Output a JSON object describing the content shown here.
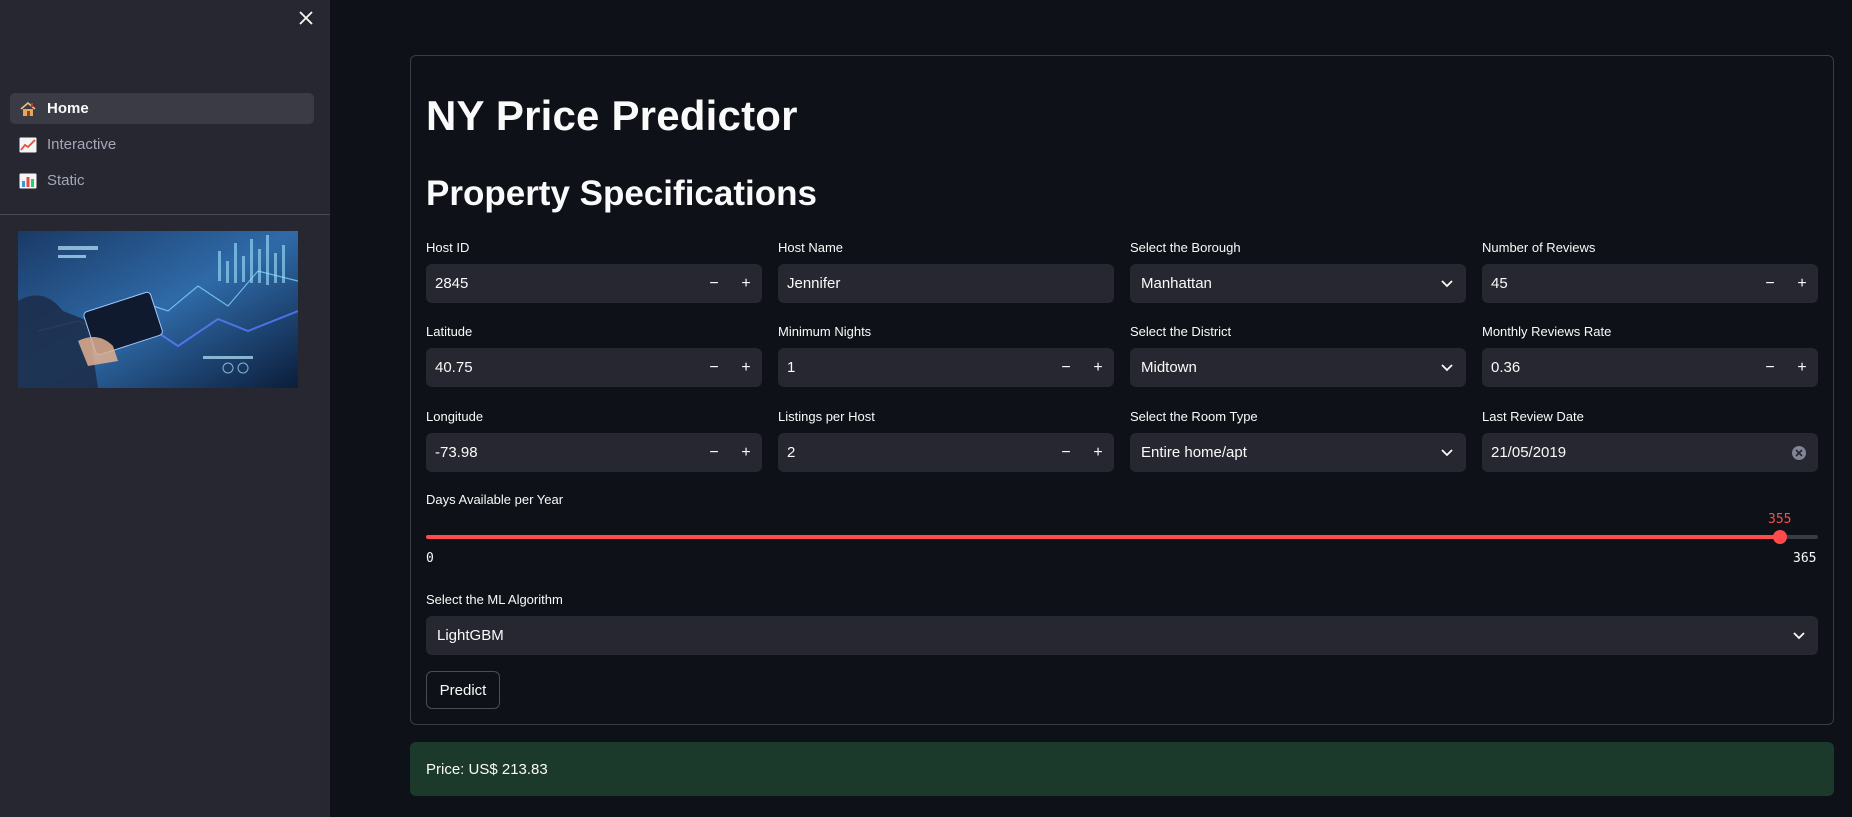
{
  "sidebar": {
    "close_icon": "close-icon",
    "items": [
      {
        "label": "Home",
        "icon": "house-icon",
        "active": true
      },
      {
        "label": "Interactive",
        "icon": "chart-increasing-icon",
        "active": false
      },
      {
        "label": "Static",
        "icon": "bar-chart-icon",
        "active": false
      }
    ],
    "image_icon": "finance-tablet-image"
  },
  "main": {
    "title": "NY Price Predictor",
    "section_title": "Property Specifications"
  },
  "fields": {
    "host_id": {
      "label": "Host ID",
      "value": "2845"
    },
    "host_name": {
      "label": "Host Name",
      "value": "Jennifer"
    },
    "borough": {
      "label": "Select the Borough",
      "value": "Manhattan"
    },
    "num_reviews": {
      "label": "Number of Reviews",
      "value": "45"
    },
    "latitude": {
      "label": "Latitude",
      "value": "40.75"
    },
    "min_nights": {
      "label": "Minimum Nights",
      "value": "1"
    },
    "district": {
      "label": "Select the District",
      "value": "Midtown"
    },
    "monthly_reviews": {
      "label": "Monthly Reviews Rate",
      "value": "0.36"
    },
    "longitude": {
      "label": "Longitude",
      "value": "-73.98"
    },
    "listings_per_host": {
      "label": "Listings per Host",
      "value": "2"
    },
    "room_type": {
      "label": "Select the Room Type",
      "value": "Entire home/apt"
    },
    "last_review": {
      "label": "Last Review Date",
      "value": "21/05/2019"
    }
  },
  "stepper": {
    "minus": "−",
    "plus": "+"
  },
  "slider": {
    "label": "Days Available per Year",
    "value": "355",
    "min": "0",
    "max": "365",
    "fraction": 0.9726
  },
  "algorithm": {
    "label": "Select the ML Algorithm",
    "value": "LightGBM"
  },
  "predict_label": "Predict",
  "result": "Price: US$ 213.83",
  "colors": {
    "background": "#0e1117",
    "sidebar": "#262730",
    "accent": "#ff4b4b",
    "success_bg": "#1c3a2b"
  }
}
